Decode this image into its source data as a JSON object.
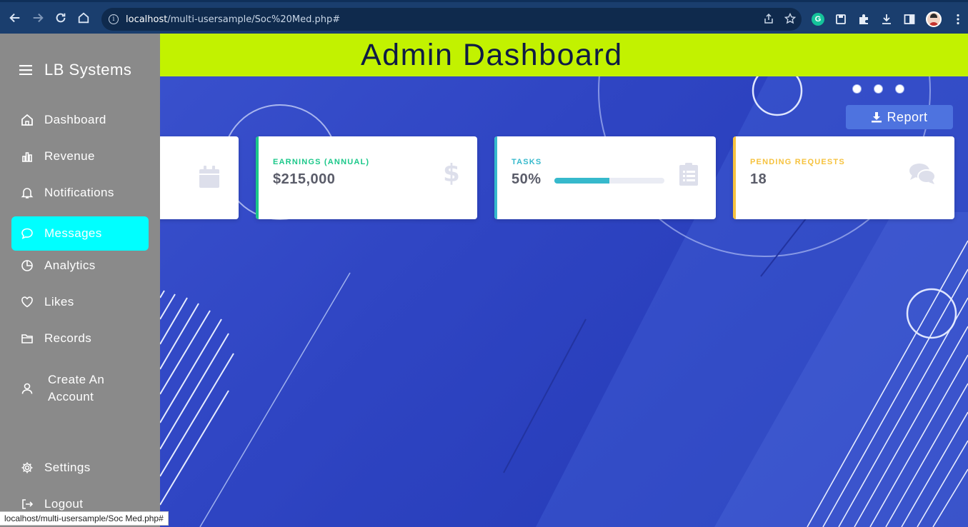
{
  "browser": {
    "url_host": "localhost",
    "url_path": "/multi-usersample/Soc%20Med.php#",
    "status_url": "localhost/multi-usersample/Soc Med.php#",
    "extension_grammarly_letter": "G"
  },
  "banner": {
    "title": "Admin Dashboard",
    "background": "#c2f200"
  },
  "sidebar": {
    "brand": "LB Systems",
    "background": "#8a8a8a",
    "active_color": "#00ffff",
    "items": [
      {
        "label": "Dashboard",
        "icon": "home-icon"
      },
      {
        "label": "Revenue",
        "icon": "bar-chart-icon"
      },
      {
        "label": "Notifications",
        "icon": "bell-icon"
      },
      {
        "label": "Messages",
        "icon": "chat-bubble-icon",
        "active": true
      },
      {
        "label": "Analytics",
        "icon": "pie-chart-icon"
      },
      {
        "label": "Likes",
        "icon": "heart-icon"
      },
      {
        "label": "Records",
        "icon": "folder-icon"
      },
      {
        "label_line1": "Create An",
        "label_line2": "Account",
        "icon": "user-icon"
      },
      {
        "label": "Settings",
        "icon": "gear-icon"
      },
      {
        "label": "Logout",
        "icon": "logout-icon"
      }
    ]
  },
  "report_button": {
    "label": "Report"
  },
  "cards": [
    {
      "label": "",
      "value": "",
      "icon": "calendar-icon",
      "accent": "#4e73df"
    },
    {
      "label": "EARNINGS (ANNUAL)",
      "value": "$215,000",
      "icon": "dollar-icon",
      "accent": "#1cc88a"
    },
    {
      "label": "TASKS",
      "value": "50%",
      "progress": 0.5,
      "icon": "clipboard-icon",
      "accent": "#36b9cc"
    },
    {
      "label": "PENDING REQUESTS",
      "value": "18",
      "icon": "comments-icon",
      "accent": "#f6c23e"
    }
  ]
}
